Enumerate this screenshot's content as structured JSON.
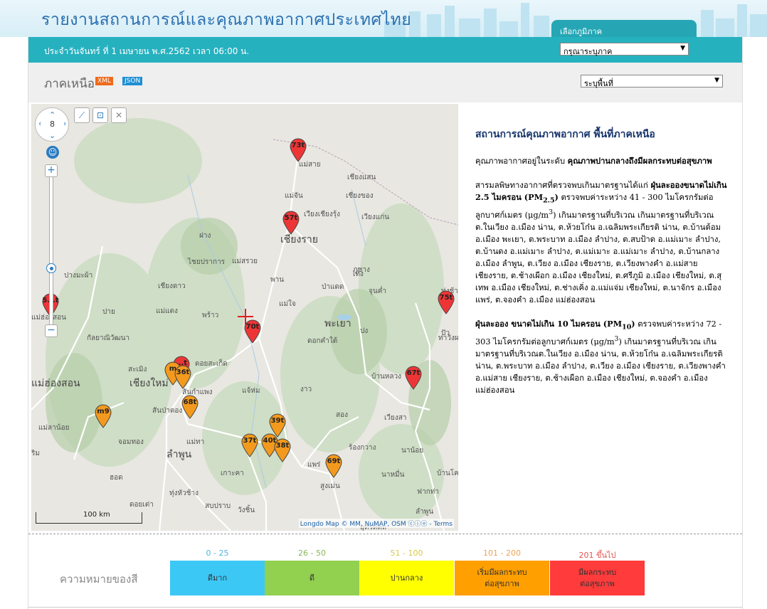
{
  "header": {
    "site_title": "รายงานสถานการณ์และคุณภาพอากาศประเทศไทย",
    "region_tab_label": "เลือกภูมิภาค",
    "date_text": "ประจำวันจันทร์ ที่ 1 เมษายน พ.ศ.2562 เวลา 06:00 น.",
    "region_select_value": "กรุณาระบุภาค"
  },
  "region_bar": {
    "region_name": "ภาคเหนือ",
    "xml_label": "XML",
    "json_label": "JSON",
    "area_select_value": "ระบุพื้นที่"
  },
  "map": {
    "zoom_level": "8",
    "scale_label": "100 km",
    "credit": "Longdo Map © MM, NuMAP, OSM ⓒⓘⓞ - Terms",
    "places": [
      {
        "name": "แม่สาย"
      },
      {
        "name": "เชียงแสน"
      },
      {
        "name": "แม่จัน"
      },
      {
        "name": "เชียงของ"
      },
      {
        "name": "เวียงเชียงรุ้ง"
      },
      {
        "name": "เวียงแก่น"
      },
      {
        "name": "ฝาง"
      },
      {
        "name": "เชียงราย"
      },
      {
        "name": "ไชยปราการ"
      },
      {
        "name": "แม่สรวย"
      },
      {
        "name": "เทิง"
      },
      {
        "name": "ภูซาง"
      },
      {
        "name": "ปางมะผ้า"
      },
      {
        "name": "พาน"
      },
      {
        "name": "เชียงดาว"
      },
      {
        "name": "ป่าแดด"
      },
      {
        "name": "จุนค่ำ"
      },
      {
        "name": "ทุ่งช้าง"
      },
      {
        "name": "ปาย"
      },
      {
        "name": "พร้าว"
      },
      {
        "name": "แม่ใจ"
      },
      {
        "name": "พะเยา"
      },
      {
        "name": "แม่ฮ่องสอน"
      },
      {
        "name": "ปัว"
      },
      {
        "name": "แม่แตง"
      },
      {
        "name": "ดอกคำใต้"
      },
      {
        "name": "ปง"
      },
      {
        "name": "กัลยาณิวัฒนา"
      },
      {
        "name": "ท่าวังผา"
      },
      {
        "name": "สะเมิง"
      },
      {
        "name": "ดอยสะเก็ด"
      },
      {
        "name": "แม่ฮ่องสอน"
      },
      {
        "name": "เชียงใหม่"
      },
      {
        "name": "สันกำแพง"
      },
      {
        "name": "แจ้ห่ม"
      },
      {
        "name": "งาว"
      },
      {
        "name": "บ้านหลวง"
      },
      {
        "name": "สันป่าตอง"
      },
      {
        "name": "แม่ทา"
      },
      {
        "name": "สอง"
      },
      {
        "name": "เวียงสา"
      },
      {
        "name": "แม่ลาน้อย"
      },
      {
        "name": "จอมทอง"
      },
      {
        "name": "ร้องกวาง"
      },
      {
        "name": "นาน้อย"
      },
      {
        "name": "ลำพูน"
      },
      {
        "name": "แพร่"
      },
      {
        "name": "เกาะคา"
      },
      {
        "name": "นาหมื่น"
      },
      {
        "name": "ฮอด"
      },
      {
        "name": "ทุ่งหัวช้าง"
      },
      {
        "name": "สูงเม่น"
      },
      {
        "name": "บ้านโคก"
      },
      {
        "name": "ดอยเต่า"
      },
      {
        "name": "สบปราบ"
      },
      {
        "name": "ฟากท่า"
      },
      {
        "name": "วังชิ้น"
      },
      {
        "name": "อุตรดิตถ์"
      },
      {
        "name": "ริม"
      },
      {
        "name": "ลำพูน"
      }
    ],
    "stations": [
      {
        "label": "73t",
        "color": "#ee3535"
      },
      {
        "label": "57t",
        "color": "#ee3535"
      },
      {
        "label": "5...t",
        "color": "#ee3535"
      },
      {
        "label": "75t",
        "color": "#ee3535"
      },
      {
        "label": "70t",
        "color": "#ee3535"
      },
      {
        "label": "...t",
        "color": "#ee3535"
      },
      {
        "label": "m",
        "color": "#f39a1e"
      },
      {
        "label": "36t",
        "color": "#f39a1e"
      },
      {
        "label": "67t",
        "color": "#ee3535"
      },
      {
        "label": "68t",
        "color": "#f39a1e"
      },
      {
        "label": "m9",
        "color": "#f39a1e"
      },
      {
        "label": "39t",
        "color": "#f39a1e"
      },
      {
        "label": "37t",
        "color": "#f39a1e"
      },
      {
        "label": "40t",
        "color": "#f39a1e"
      },
      {
        "label": "38t",
        "color": "#f39a1e"
      },
      {
        "label": "69t",
        "color": "#f39a1e"
      }
    ]
  },
  "info": {
    "title": "สถานการณ์คุณภาพอากาศ พื้นที่ภาคเหนือ",
    "level_intro": "คุณภาพอากาศอยู่ในระดับ ",
    "level_value": "คุณภาพปานกลางถึงมีผลกระทบต่อสุขภาพ",
    "pm25_intro": "สารมลพิษทางอากาศที่ตรวจพบเกินมาตรฐานได้แก่ ",
    "pm25_name": "ฝุ่นละอองขนาดไม่เกิน 2.5 ไมครอน (PM",
    "pm25_sub": "2.5",
    "pm25_close": ")",
    "pm25_range": " ตรวจพบค่าระหว่าง 41 - 300 ไมโครกรัมต่อลูกบาศก์เมตร (μg/m",
    "pm25_unit_sup": "3",
    "pm25_detail": ") เกินมาตรฐานที่บริเวณ เกินมาตรฐานที่บริเวณต.ในเวียง อ.เมือง น่าน, ต.ห้วยโก๋น อ.เฉลิมพระเกียรติ น่าน, ต.บ้านต้อม อ.เมือง พะเยา, ต.พระบาท อ.เมือง ลำปาง, ต.สบป้าด อ.แม่เมาะ ลำปาง, ต.บ้านดง อ.แม่เมาะ ลำปาง, ต.แม่เมาะ อ.แม่เมาะ ลำปาง, ต.บ้านกลาง อ.เมือง ลำพูน, ต.เวียง อ.เมือง เชียงราย, ต.เวียงพางคำ อ.แม่สาย เชียงราย, ต.ช้างเผือก อ.เมือง เชียงใหม่, ต.ศรีภูมิ อ.เมือง เชียงใหม่, ต.สุเทพ อ.เมือง เชียงใหม่, ต.ช่างเคิ่ง อ.แม่แจ่ม เชียงใหม่, ต.นาจักร อ.เมือง แพร่, ต.จองคำ อ.เมือง แม่ฮ่องสอน",
    "pm10_name": "ฝุ่นละออง ขนาดไม่เกิน 10 ไมครอน (PM",
    "pm10_sub": "10",
    "pm10_close": ")",
    "pm10_range": " ตรวจพบค่าระหว่าง 72 - 303 ไมโครกรัมต่อลูกบาศก์เมตร (μg/m",
    "pm10_unit_sup": "3",
    "pm10_detail": ") เกินมาตรฐานที่บริเวณ เกินมาตรฐานที่บริเวณต.ในเวียง อ.เมือง น่าน, ต.ห้วยโก๋น อ.เฉลิมพระเกียรติ น่าน, ต.พระบาท อ.เมือง ลำปาง, ต.เวียง อ.เมือง เชียงราย, ต.เวียงพางคำ อ.แม่สาย เชียงราย, ต.ช้างเผือก อ.เมือง เชียงใหม่, ต.จองคำ อ.เมือง แม่ฮ่องสอน"
  },
  "legend": {
    "title": "ความหมายของสี",
    "items": [
      {
        "range": "0 - 25",
        "label": "ดีมาก",
        "color": "#3cc8f5",
        "range_color": "#4fb7e0"
      },
      {
        "range": "26 - 50",
        "label": "ดี",
        "color": "#92d050",
        "range_color": "#8ab85a"
      },
      {
        "range": "51 - 100",
        "label": "ปานกลาง",
        "color": "#ffff00",
        "range_color": "#d6c94a"
      },
      {
        "range": "101 - 200",
        "label": "เริ่มมีผลกระทบ\nต่อสุขภาพ",
        "color": "#ff9f00",
        "range_color": "#e9a55a"
      },
      {
        "range": "201 ขึ้นไป",
        "label": "มีผลกระทบ\nต่อสุขภาพ",
        "color": "#ff3b3b",
        "range_color": "#e0524f"
      }
    ]
  }
}
